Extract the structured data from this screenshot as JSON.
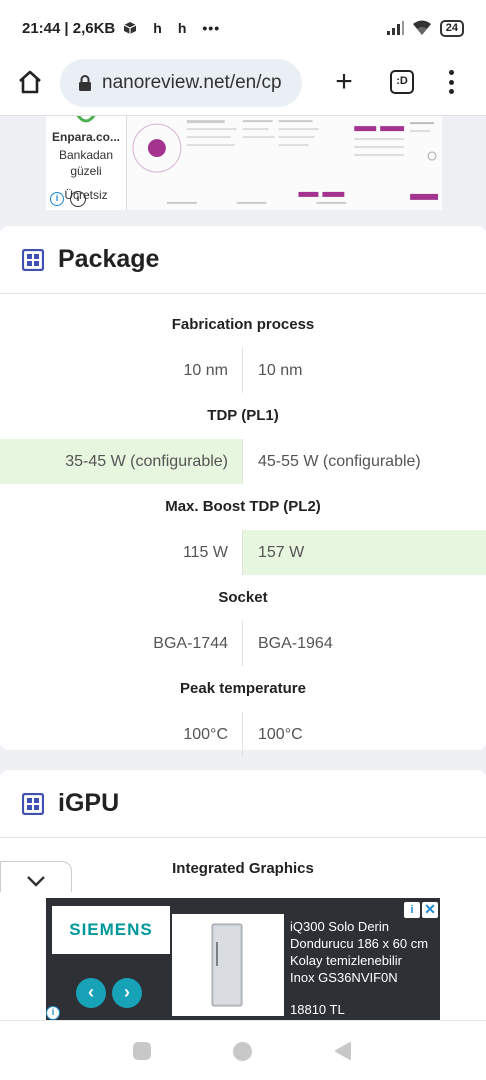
{
  "status_bar": {
    "time": "21:44",
    "data_speed": "| 2,6KB",
    "notif_1": "h",
    "notif_2": "h",
    "more": "•••",
    "battery": "24"
  },
  "browser": {
    "url": "nanoreview.net/en/cp",
    "tab_label": ":D"
  },
  "ad_top": {
    "brand": "Enpara.co...",
    "line1": "Bankadan",
    "line2": "güzeli",
    "line3": "Ücretsiz"
  },
  "package": {
    "title": "Package",
    "specs": [
      {
        "label": "Fabrication process",
        "left": "10 nm",
        "right": "10 nm",
        "winner": "none"
      },
      {
        "label": "TDP (PL1)",
        "left": "35-45 W (configurable)",
        "right": "45-55 W (configurable)",
        "winner": "left"
      },
      {
        "label": "Max. Boost TDP (PL2)",
        "left": "115 W",
        "right": "157 W",
        "winner": "right"
      },
      {
        "label": "Socket",
        "left": "BGA-1744",
        "right": "BGA-1964",
        "winner": "none"
      },
      {
        "label": "Peak temperature",
        "left": "100°C",
        "right": "100°C",
        "winner": "none"
      }
    ]
  },
  "igpu": {
    "title": "iGPU",
    "first_label": "Integrated Graphics"
  },
  "ad_bottom": {
    "brand": "SIEMENS",
    "description": "iQ300 Solo Derin Dondurucu 186 x 60 cm Kolay temizlenebilir Inox GS36NVIF0N",
    "price": "18810 TL"
  },
  "colors": {
    "winner_bg": "#e6f6df",
    "accent_icon": "#3f51b5",
    "ad_teal": "#009999"
  }
}
